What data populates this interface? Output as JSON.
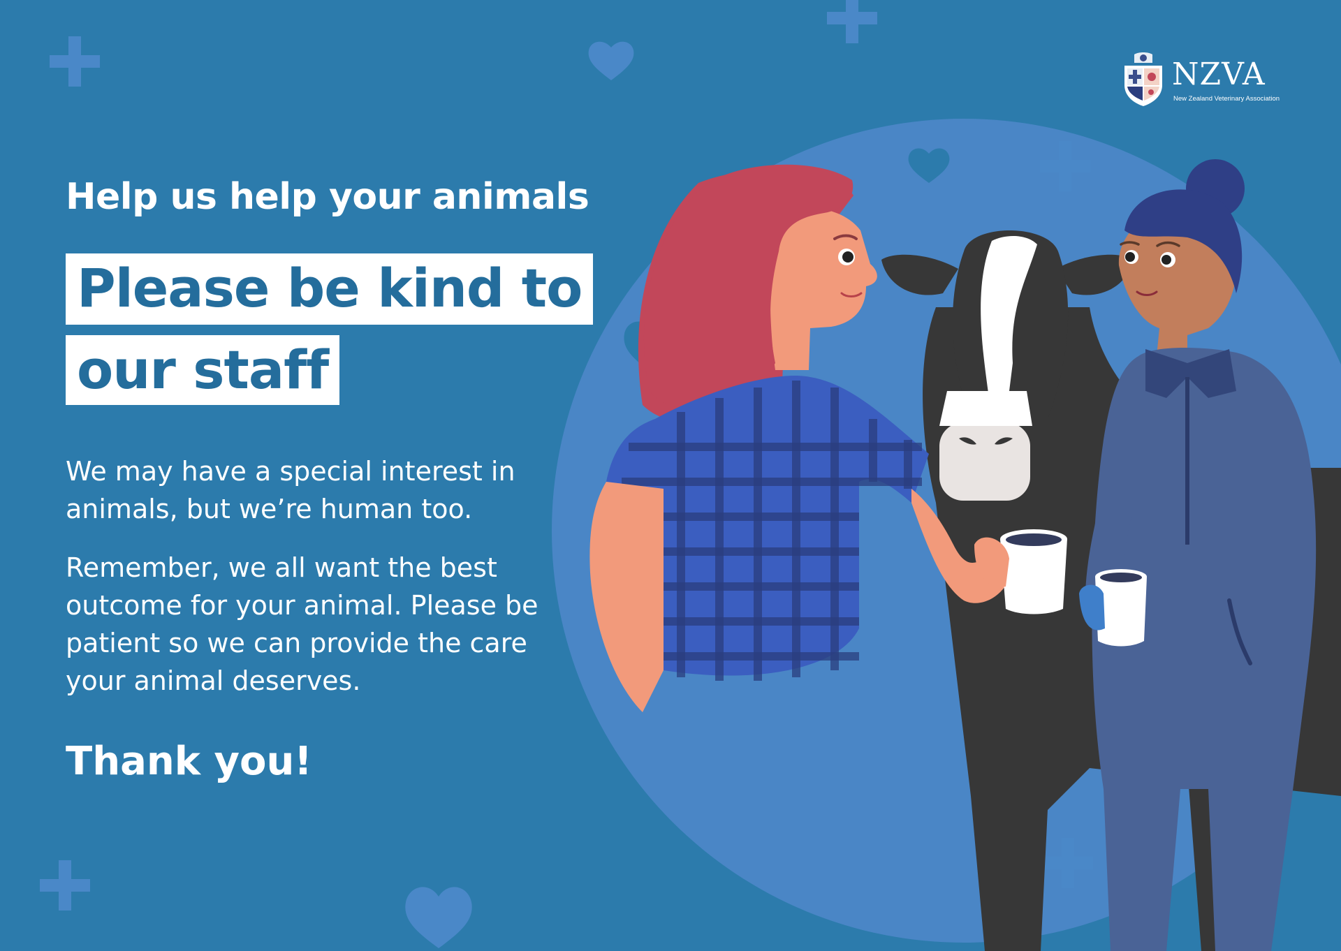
{
  "poster": {
    "kicker": "Help us help your animals",
    "headline_line1": "Please be kind to",
    "headline_line2": "our staff",
    "paragraph1": "We may have a special interest in animals, but we’re human too.",
    "paragraph2": "Remember, we all want the best outcome for your animal. Please be patient so we can provide the care your animal deserves.",
    "closing": "Thank you!"
  },
  "logo": {
    "name": "NZVA",
    "tagline": "New Zealand Veterinary Association"
  },
  "illustration": {
    "subjects": [
      "woman-red-hair-icon",
      "cow-icon",
      "woman-overalls-icon"
    ],
    "decor_icons": [
      "plus-icon",
      "heart-icon"
    ]
  },
  "colors": {
    "background": "#2c7bac",
    "circle": "#4a86c6",
    "headline_text": "#246d9c",
    "headline_box": "#ffffff",
    "decor": "#4a88c8"
  }
}
